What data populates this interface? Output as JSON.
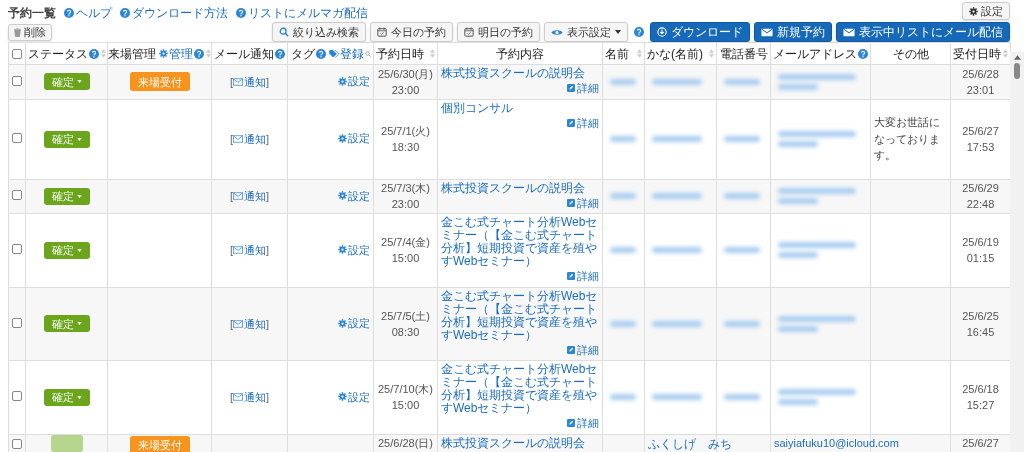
{
  "page": {
    "title": "予約一覧",
    "links": [
      "ヘルプ",
      "ダウンロード方法",
      "リストにメルマガ配信"
    ]
  },
  "settings_button": "設定",
  "delete_button": "削除",
  "toolbar": [
    {
      "kind": "search",
      "label": "絞り込み検索"
    },
    {
      "kind": "today",
      "label": "今日の予約"
    },
    {
      "kind": "tomorrow",
      "label": "明日の予約"
    },
    {
      "kind": "display",
      "label": "表示設定"
    },
    {
      "kind": "help"
    },
    {
      "kind": "download",
      "label": "ダウンロード"
    },
    {
      "kind": "new",
      "label": "新規予約"
    },
    {
      "kind": "mail",
      "label": "表示中リストにメール配信"
    }
  ],
  "table": {
    "columns": [
      {
        "kind": "checkbox",
        "checked": false
      },
      {
        "kind": "plain",
        "label": "ステータス",
        "help": true,
        "sortable": true
      },
      {
        "kind": "manage",
        "label": "来場管理",
        "link": "管理",
        "help": true,
        "sortable": true
      },
      {
        "kind": "plain",
        "label": "メール通知",
        "help": true,
        "sortable": false
      },
      {
        "kind": "tag",
        "label": "タグ",
        "link": "登録",
        "help": true,
        "sortable": false
      },
      {
        "kind": "plain",
        "label": "予約日時",
        "help": false,
        "sortable": true
      },
      {
        "kind": "plain",
        "label": "予約内容",
        "help": false,
        "sortable": false
      },
      {
        "kind": "plain",
        "label": "名前",
        "help": false,
        "sortable": true
      },
      {
        "kind": "plain",
        "label": "かな(名前)",
        "help": false,
        "sortable": true
      },
      {
        "kind": "plain",
        "label": "電話番号",
        "help": false,
        "sortable": false
      },
      {
        "kind": "plain",
        "label": "メールアドレス",
        "help": true,
        "sortable": false
      },
      {
        "kind": "plain",
        "label": "その他",
        "help": false,
        "sortable": false
      },
      {
        "kind": "plain",
        "label": "受付日時",
        "help": false,
        "sortable": true
      }
    ],
    "rows": [
      {
        "checked": false,
        "status": "確定",
        "reception": "来場受付",
        "mail_open": "[",
        "mail": "通知",
        "mail_close": "]",
        "tag": "設定",
        "date": "25/6/30(月)",
        "time": "23:00",
        "content": "株式投資スクールの説明会",
        "detail": "詳細",
        "received_date": "25/6/28",
        "received_time": "23:01"
      },
      {
        "checked": false,
        "status": "確定",
        "mail_open": "[",
        "mail": "通知",
        "mail_close": "]",
        "tag": "設定",
        "date": "25/7/1(火)",
        "time": "18:30",
        "content": "個別コンサル",
        "detail": "詳細",
        "other": "大変お世話になっております。",
        "received_date": "25/6/27",
        "received_time": "17:53"
      },
      {
        "checked": false,
        "status": "確定",
        "mail_open": "[",
        "mail": "通知",
        "mail_close": "]",
        "tag": "設定",
        "date": "25/7/3(木)",
        "time": "23:00",
        "content": "株式投資スクールの説明会",
        "detail": "詳細",
        "received_date": "25/6/29",
        "received_time": "22:48"
      },
      {
        "checked": false,
        "status": "確定",
        "mail_open": "[",
        "mail": "通知",
        "mail_close": "]",
        "tag": "設定",
        "date": "25/7/4(金)",
        "time": "15:00",
        "content": "金こむ式チャート分析Webセミナー（【金こむ式チャート分析】短期投資で資産を殖やすWebセミナー）",
        "detail": "詳細",
        "received_date": "25/6/19",
        "received_time": "01:15"
      },
      {
        "checked": false,
        "status": "確定",
        "mail_open": "[",
        "mail": "通知",
        "mail_close": "]",
        "tag": "設定",
        "date": "25/7/5(土)",
        "time": "08:30",
        "content": "金こむ式チャート分析Webセミナー（【金こむ式チャート分析】短期投資で資産を殖やすWebセミナー）",
        "detail": "詳細",
        "received_date": "25/6/25",
        "received_time": "16:45"
      },
      {
        "checked": false,
        "status": "確定",
        "mail_open": "[",
        "mail": "通知",
        "mail_close": "]",
        "tag": "設定",
        "date": "25/7/10(木)",
        "time": "15:00",
        "content": "金こむ式チャート分析Webセミナー（【金こむ式チャート分析】短期投資で資産を殖やすWebセミナー）",
        "detail": "詳細",
        "received_date": "25/6/18",
        "received_time": "15:27"
      },
      {
        "checked": false,
        "reception": "来場受付",
        "date": "25/6/28(日)",
        "content": "株式投資スクールの説明会",
        "kana": "ふくしげ　みち",
        "email": "saiyiafuku10@icloud.com",
        "received_date": "25/6/27"
      }
    ]
  }
}
